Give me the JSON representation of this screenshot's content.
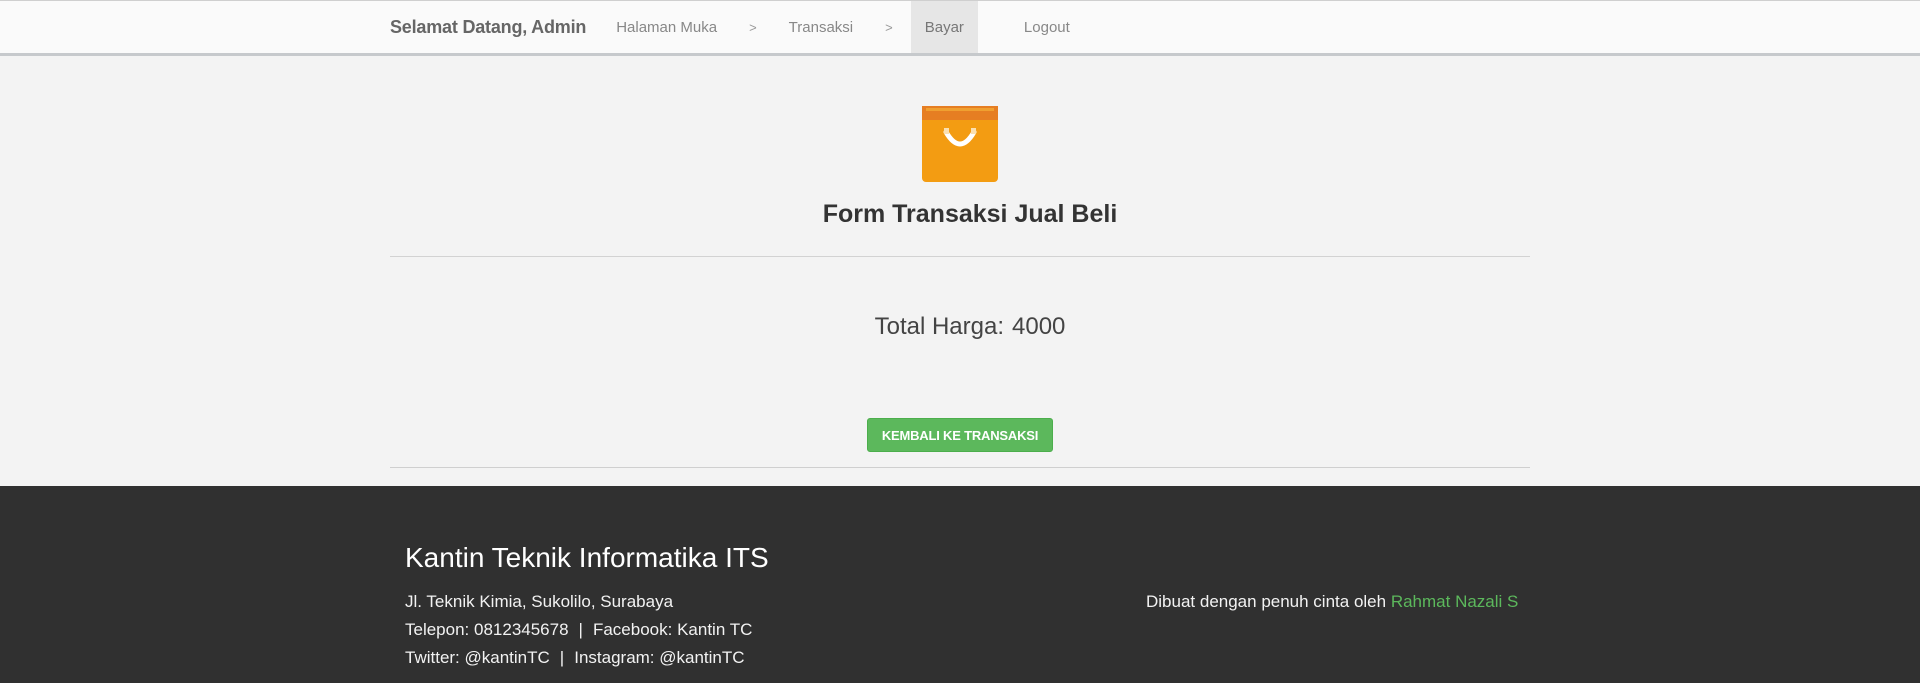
{
  "navbar": {
    "brand": "Selamat Datang, Admin",
    "items": [
      {
        "label": "Halaman Muka"
      },
      {
        "label": "Transaksi"
      },
      {
        "label": "Bayar"
      }
    ],
    "separator": ">",
    "logout": "Logout"
  },
  "main": {
    "icon": "shopping-bag-icon",
    "title": "Form Transaksi Jual Beli",
    "total_label": "Total Harga:",
    "total_value": "4000",
    "back_button": "KEMBALI KE TRANSAKSI"
  },
  "footer": {
    "title": "Kantin Teknik Informatika ITS",
    "address": "Jl. Teknik Kimia, Sukolilo, Surabaya",
    "phone": "Telepon: 0812345678",
    "facebook": "Facebook: Kantin TC",
    "twitter": "Twitter: @kantinTC",
    "instagram": "Instagram: @kantinTC",
    "pipe": "|",
    "credit_text": "Dibuat dengan penuh cinta oleh",
    "credit_name": "Rahmat Nazali S"
  },
  "colors": {
    "accent_green": "#5cb85c",
    "footer_bg": "#303030",
    "bag_orange": "#f39c12"
  }
}
